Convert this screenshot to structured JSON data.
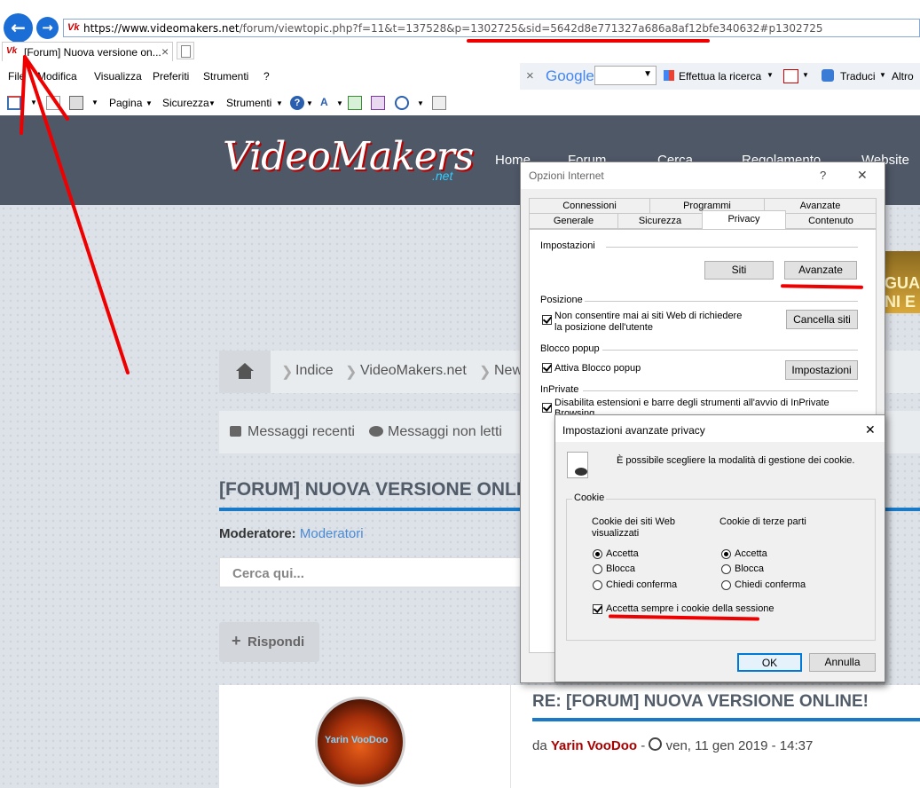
{
  "browser": {
    "address_domain": "https://www.videomakers.net",
    "address_path": "/forum/viewtopic.php?f=11&t=137528&p=1302725&sid=5642d8e771327a686a8af12bfe340632#p1302725",
    "tab_title": "[Forum] Nuova versione on...",
    "tab_close": "×"
  },
  "menu": {
    "items": [
      "File",
      "Modifica",
      "Visualizza",
      "Preferiti",
      "Strumenti",
      "?"
    ],
    "google": "Google",
    "search_button": "Effettua la ricerca",
    "translate": "Traduci",
    "more": "Altro"
  },
  "commandbar": {
    "items": [
      "Pagina",
      "Sicurezza",
      "Strumenti"
    ]
  },
  "site": {
    "logo_text": "VideoMakers",
    "logo_suffix": ".net",
    "nav": [
      "Home",
      "Forum",
      "Cerca",
      "Regolamento",
      "Website"
    ],
    "banner_lines": [
      "GUA",
      "NI E"
    ],
    "breadcrumb": [
      "Indice",
      "VideoMakers.net",
      "New"
    ],
    "recent": "Messaggi recenti",
    "unread": "Messaggi non letti",
    "topic_title": "[FORUM] NUOVA VERSIONE ONLINE",
    "moderator_label": "Moderatore:",
    "moderator_value": "Moderatori",
    "search_placeholder": "Cerca qui...",
    "reply_button": "Rispondi",
    "post_title": "RE: [FORUM] NUOVA VERSIONE ONLINE!",
    "post_by": "da",
    "post_author": "Yarin VooDoo",
    "post_date": "ven, 11 gen 2019 - 14:37",
    "avatar_text": "Yarin VooDoo"
  },
  "internet_options": {
    "title": "Opzioni Internet",
    "help": "?",
    "close": "✕",
    "tabs_top": [
      "Connessioni",
      "Programmi",
      "Avanzate"
    ],
    "tabs_bottom": [
      "Generale",
      "Sicurezza",
      "Privacy",
      "Contenuto"
    ],
    "impostazioni": "Impostazioni",
    "siti": "Siti",
    "avanzate": "Avanzate",
    "posizione": "Posizione",
    "posizione_check_1": "Non consentire mai ai siti Web di richiedere",
    "posizione_check_2": "la posizione dell'utente",
    "cancella_siti": "Cancella siti",
    "blocco_popup": "Blocco popup",
    "attiva_blocco": "Attiva Blocco popup",
    "impostazioni_btn": "Impostazioni",
    "inprivate": "InPrivate",
    "inprivate_check_1": "Disabilita estensioni e barre degli strumenti all'avvio di InPrivate",
    "inprivate_check_2": "Browsing"
  },
  "advanced_privacy": {
    "title": "Impostazioni avanzate privacy",
    "close": "✕",
    "description": "È possibile scegliere la modalità di gestione dei cookie.",
    "cookie_group": "Cookie",
    "first_party_1": "Cookie dei siti Web",
    "first_party_2": "visualizzati",
    "third_party": "Cookie di terze parti",
    "options": [
      "Accetta",
      "Blocca",
      "Chiedi conferma"
    ],
    "session": "Accetta sempre i cookie della sessione",
    "ok": "OK",
    "cancel": "Annulla"
  }
}
